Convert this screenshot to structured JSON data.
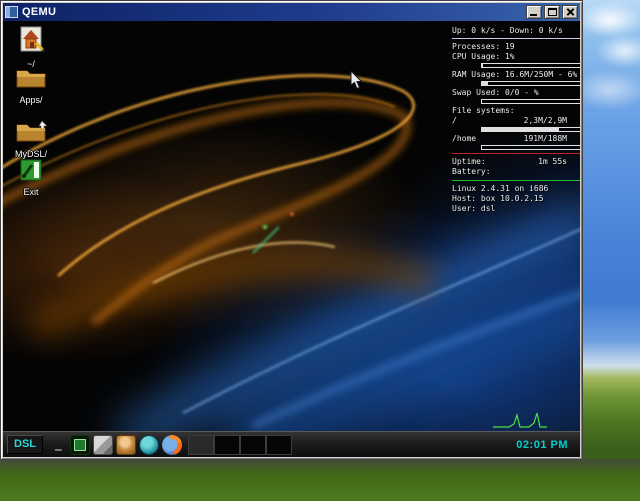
{
  "window": {
    "title": "QEMU",
    "controls": [
      "minimize-icon",
      "maximize-icon",
      "close-icon"
    ]
  },
  "desktop_icons": [
    {
      "label": "~/",
      "icon": "home-icon"
    },
    {
      "label": "Apps/",
      "icon": "folder-icon"
    },
    {
      "label": "MyDSL/",
      "icon": "folder-icon"
    },
    {
      "label": "Exit",
      "icon": "exit-icon"
    }
  ],
  "sysmon": {
    "net": "Up: 0 k/s - Down: 0 k/s",
    "processes": "Processes: 19",
    "cpu": "CPU Usage: 1%",
    "cpu_pct": 1,
    "ram": "RAM Usage: 16.6M/250M - 6%",
    "ram_pct": 6,
    "swap": "Swap Used: 0/0 - %",
    "swap_pct": 0,
    "fs_header": "File systems:",
    "fs1_mount": "/",
    "fs1_usage": "2,3M/2,9M",
    "fs1_pct": 79,
    "fs2_mount": "/home",
    "fs2_usage": "191M/188M",
    "fs2_pct": 0,
    "uptime_label": "Uptime:",
    "uptime_value": "1m 55s",
    "battery_label": "Battery:",
    "os": "Linux 2.4.31 on i686",
    "host": "Host: box 10.0.2.15",
    "user": "User: dsl"
  },
  "taskbar": {
    "workspace": "DSL",
    "iconified_marker": "_",
    "launcher_icons": [
      "terminal-icon",
      "package-icon",
      "figure-icon",
      "globe-icon",
      "firefox-icon"
    ],
    "workspace_count": 4,
    "clock": "02:01 PM"
  },
  "colors": {
    "clock_accent": "#00d2d2",
    "titlebar_navy": "#0e2266",
    "sysmon_red_rule": "#c42424",
    "sysmon_green_rule": "#28b828"
  }
}
